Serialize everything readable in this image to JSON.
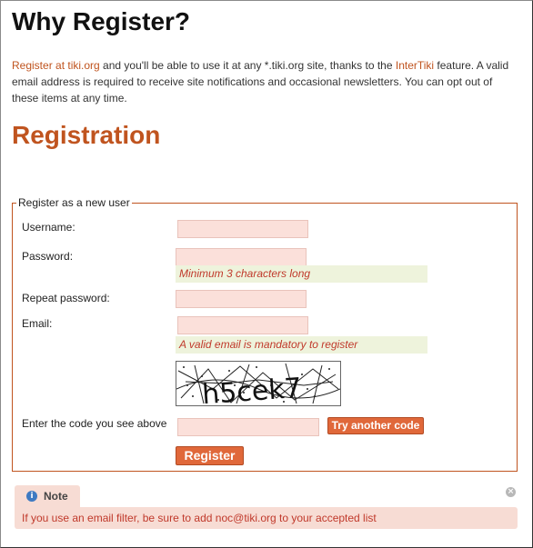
{
  "page": {
    "heading": "Why Register?",
    "intro": {
      "link1": "Register at tiki.org",
      "text1": " and you'll be able to use it at any *.tiki.org site, thanks to the ",
      "link2": "InterTiki",
      "text2": " feature. A valid email address is required to receive site notifications and occasional newsletters. You can opt out of these items at any time."
    },
    "registration_heading": "Registration"
  },
  "form": {
    "legend": "Register as a new user",
    "username_label": "Username:",
    "password_label": "Password:",
    "password_hint": "Minimum 3 characters long",
    "repeat_password_label": "Repeat password:",
    "email_label": "Email:",
    "email_hint": "A valid email is mandatory to register",
    "captcha_text": "h5cek7",
    "captcha_label": "Enter the code you see above",
    "try_another_label": "Try another code",
    "register_label": "Register"
  },
  "note": {
    "title": "Note",
    "icon": "info-icon",
    "message": "If you use an email filter, be sure to add noc@tiki.org to your accepted list"
  },
  "colors": {
    "accent": "#c0541f",
    "button": "#e0683a",
    "input_bg": "#fbe0da",
    "hint_bg": "#eef3dc",
    "note_bg": "#f7dcd4"
  }
}
